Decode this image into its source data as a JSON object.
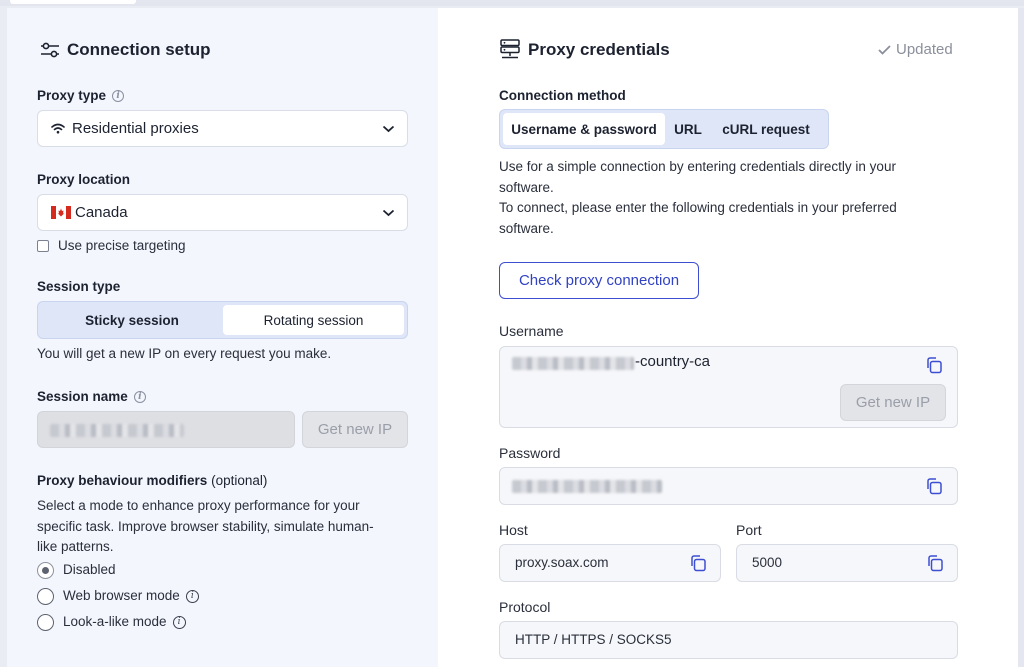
{
  "connection_setup": {
    "title": "Connection setup",
    "proxy_type": {
      "label": "Proxy type",
      "value": "Residential proxies"
    },
    "proxy_location": {
      "label": "Proxy location",
      "value": "Canada",
      "precise_label": "Use precise targeting"
    },
    "session_type": {
      "label": "Session type",
      "options": [
        "Sticky session",
        "Rotating session"
      ],
      "selected": "Rotating session",
      "hint": "You will get a new IP on every request you make."
    },
    "session_name": {
      "label": "Session name",
      "button": "Get new IP"
    },
    "modifiers": {
      "label": "Proxy behaviour modifiers",
      "optional": "(optional)",
      "description": [
        "Select a mode to enhance proxy performance for your",
        "specific task. Improve browser stability, simulate human-",
        "like patterns."
      ],
      "options": [
        "Disabled",
        "Web browser mode",
        "Look-a-like mode"
      ],
      "selected": "Disabled"
    }
  },
  "credentials": {
    "title": "Proxy credentials",
    "status": "Updated",
    "connection_method": {
      "label": "Connection method",
      "tabs": [
        "Username & password",
        "URL",
        "cURL request"
      ],
      "selected": "Username & password"
    },
    "description": [
      "Use for a simple connection by entering credentials directly in your",
      "software.",
      "To connect, please enter the following credentials in your preferred",
      "software."
    ],
    "check_button": "Check proxy connection",
    "username": {
      "label": "Username",
      "suffix": "-country-ca",
      "button": "Get new IP"
    },
    "password": {
      "label": "Password"
    },
    "host": {
      "label": "Host",
      "value": "proxy.soax.com"
    },
    "port": {
      "label": "Port",
      "value": "5000"
    },
    "protocol": {
      "label": "Protocol",
      "value": "HTTP / HTTPS / SOCKS5"
    }
  },
  "colors": {
    "accent": "#3d4ed1",
    "left_bg": "#f3f6fd",
    "segment_bg": "#dfe6f8"
  }
}
